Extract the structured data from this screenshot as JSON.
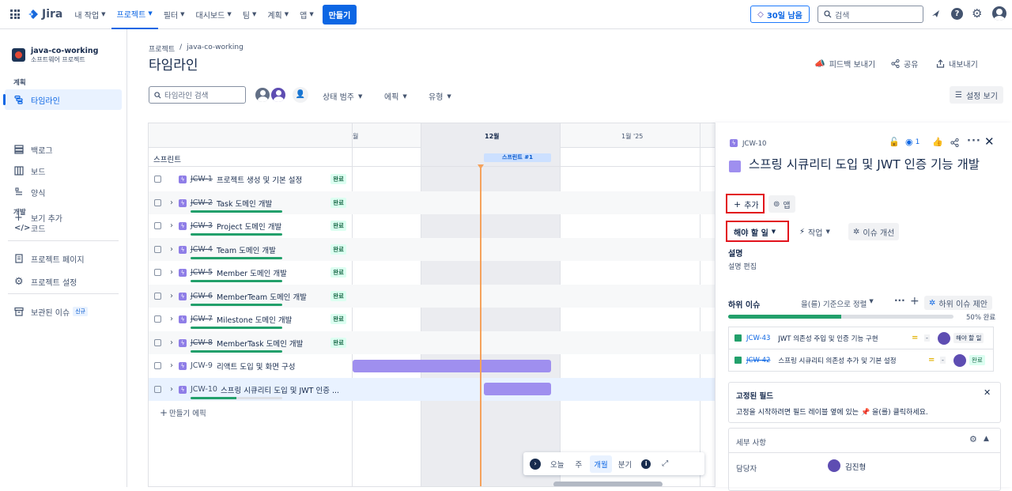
{
  "topnav": {
    "logo": "Jira",
    "items": [
      {
        "label": "내 작업"
      },
      {
        "label": "프로젝트"
      },
      {
        "label": "필터"
      },
      {
        "label": "대시보드"
      },
      {
        "label": "팀"
      },
      {
        "label": "계획"
      },
      {
        "label": "앱"
      }
    ],
    "create_label": "만들기",
    "trial_label": "30일 남음",
    "search_placeholder": "검색"
  },
  "sidebar": {
    "project_name": "java-co-working",
    "project_type": "소프트웨어 프로젝트",
    "group_plan": "계획",
    "items_plan": [
      {
        "label": "타임라인"
      },
      {
        "label": "백로그"
      },
      {
        "label": "보드"
      },
      {
        "label": "양식"
      },
      {
        "label": "보기 추가"
      }
    ],
    "group_dev": "개발",
    "code_label": "코드",
    "project_page": "프로젝트 페이지",
    "project_settings": "프로젝트 설정",
    "archived": "보관된 이슈",
    "archived_badge": "신규"
  },
  "main": {
    "breadcrumb_root": "프로젝트",
    "breadcrumb_sep": "/",
    "breadcrumb_project": "java-co-working",
    "page_title": "타임라인",
    "feedback": "피드백 보내기",
    "share": "공유",
    "export": "내보내기",
    "search_placeholder": "타임라인 검색",
    "filter_status": "상태 범주",
    "filter_epic": "에픽",
    "filter_type": "유형",
    "view_settings": "설정 보기"
  },
  "timeline": {
    "months": [
      "월",
      "12월",
      "1월 '25"
    ],
    "sprints_label": "스프린트",
    "sprint_chip": "스프린트 #1",
    "rows": [
      {
        "key": "JCW-1",
        "title": "프로젝트 생성 및 기본 설정",
        "status": "완료",
        "done": true,
        "expandable": false
      },
      {
        "key": "JCW-2",
        "title": "Task 도메인 개발",
        "status": "완료",
        "done": true,
        "expandable": true
      },
      {
        "key": "JCW-3",
        "title": "Project 도메인 개발",
        "status": "완료",
        "done": true,
        "expandable": true
      },
      {
        "key": "JCW-4",
        "title": "Team 도메인 개발",
        "status": "완료",
        "done": true,
        "expandable": true
      },
      {
        "key": "JCW-5",
        "title": "Member 도메인 개발",
        "status": "완료",
        "done": true,
        "expandable": true
      },
      {
        "key": "JCW-6",
        "title": "MemberTeam 도메인 개발",
        "status": "완료",
        "done": true,
        "expandable": true
      },
      {
        "key": "JCW-7",
        "title": "Milestone 도메인 개발",
        "status": "완료",
        "done": true,
        "expandable": true
      },
      {
        "key": "JCW-8",
        "title": "MemberTask 도메인 개발",
        "status": "완료",
        "done": true,
        "expandable": true
      },
      {
        "key": "JCW-9",
        "title": "리액트 도입 및 화면 구성",
        "status": "",
        "done": false,
        "expandable": true
      },
      {
        "key": "JCW-10",
        "title": "스프링 시큐리티 도입 및 JWT 인증 ...",
        "status": "",
        "done": false,
        "expandable": true
      }
    ],
    "create_epic": "만들기 에픽",
    "zoom": {
      "today": "오늘",
      "week": "주",
      "month": "개월",
      "quarter": "분기"
    }
  },
  "panel": {
    "issue_key": "JCW-10",
    "watchers": "1",
    "title": "스프링 시큐리티 도입 및 JWT 인증 기능 개발",
    "add_label": "추가",
    "apps_label": "앱",
    "status_label": "해야 할 일",
    "action_label": "작업",
    "improve_label": "이슈 개선",
    "desc_heading": "설명",
    "desc_edit": "설명 편집",
    "child_heading": "하위 이슈",
    "child_sort": "을(를) 기준으로 정렬",
    "child_suggest": "하위 이슈 제안",
    "child_progress_text": "50% 완료",
    "child_progress": 0.5,
    "children": [
      {
        "key": "JCW-43",
        "title": "JWT 의존성 주입 및 인증 기능 구현",
        "priority": "-",
        "status": "해야 할 일",
        "done": false
      },
      {
        "key": "JCW-42",
        "title": "스프링 시큐리티 의존성 추가 및 기본 설정",
        "priority": "-",
        "status": "완료",
        "done": true
      }
    ],
    "pinned_heading": "고정된 필드",
    "pinned_text": "고정을 시작하려면 필드 레이블 옆에 있는",
    "pinned_text2": "을(를) 클릭하세요.",
    "details_heading": "세부 사항",
    "assignee_label": "담당자",
    "assignee_name": "김진형"
  },
  "colors": {
    "accent": "#0c66e4",
    "epic": "#8f7ee7",
    "done_green": "#22a06b",
    "today_line": "#f5a25c",
    "highlight": "#e2121c"
  }
}
